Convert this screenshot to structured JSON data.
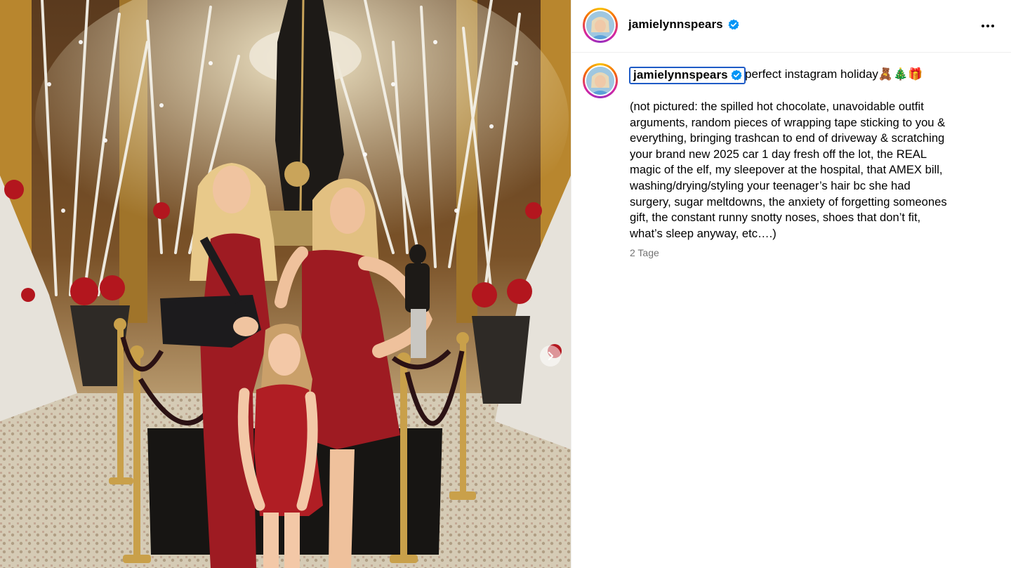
{
  "post": {
    "author": {
      "username": "jamielynnspears",
      "verified": true,
      "avatar_icon": "profile-avatar"
    },
    "menu_icon": "more-horizontal-icon",
    "caption": {
      "username": "jamielynnspears",
      "headline": "perfect instagram holiday🧸🎄🎁",
      "body": "(not pictured: the spilled hot chocolate, unavoidable outfit\narguments, random pieces of wrapping tape sticking to you &\neverything, bringing trashcan to end of driveway & scratching\nyour brand new 2025 car 1 day fresh off the lot, the REAL\nmagic of the elf, my sleepover at the hospital, that AMEX bill,\nwashing/drying/styling your teenager’s hair bc she had\nsurgery, sugar meltdowns, the anxiety of forgetting someones\ngift, the constant runny snotty noses, shoes that don’t fit,\nwhat’s sleep anyway, etc….)",
      "timestamp": "2 Tage"
    },
    "media": {
      "next_icon": "chevron-right-icon"
    }
  },
  "colors": {
    "verified_badge": "#0095f6",
    "selection_outline": "#1e5bc6",
    "timestamp": "#737373",
    "dress_red": "#9e1b22"
  }
}
